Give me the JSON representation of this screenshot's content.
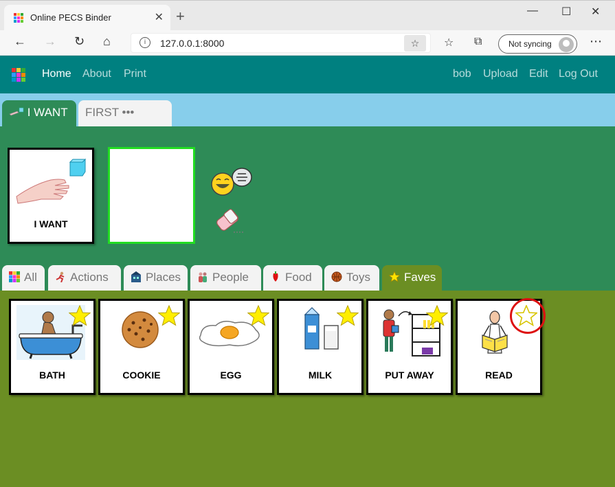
{
  "browser": {
    "tab_title": "Online PECS Binder",
    "url": "127.0.0.1:8000",
    "sync_label": "Not syncing",
    "minimize": "—",
    "maximize": "☐",
    "close": "✕",
    "new_tab": "+",
    "more": "⋯"
  },
  "nav": {
    "links": [
      "Home",
      "About",
      "Print"
    ],
    "user": "bob",
    "upload": "Upload",
    "edit": "Edit",
    "logout": "Log Out"
  },
  "strip_tabs": [
    "I WANT",
    "FIRST ••• THEN"
  ],
  "sentence": {
    "card_label": "I WANT"
  },
  "categories": [
    "All",
    "Actions",
    "Places",
    "People",
    "Food",
    "Toys",
    "Faves"
  ],
  "active_category": "Faves",
  "cards": [
    {
      "label": "BATH",
      "faved": true
    },
    {
      "label": "COOKIE",
      "faved": true
    },
    {
      "label": "EGG",
      "faved": true
    },
    {
      "label": "MILK",
      "faved": true
    },
    {
      "label": "PUT AWAY",
      "faved": true
    },
    {
      "label": "READ",
      "faved": false
    }
  ],
  "colors": {
    "navbar": "#008080",
    "strip": "#87ceeb",
    "sentence_bg": "#2e8b57",
    "grid_bg": "#6b8e23",
    "star_fill": "#ffee00",
    "highlight_ring": "#dd1111"
  }
}
